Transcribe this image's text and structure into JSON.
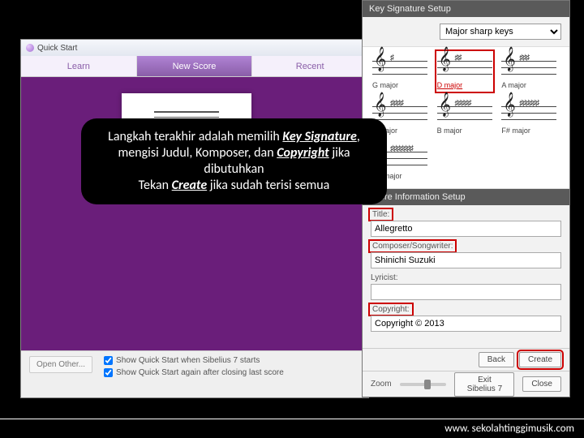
{
  "quickstart": {
    "title": "Quick Start",
    "tabs": [
      "Learn",
      "New Score",
      "Recent"
    ],
    "active_tab": 1,
    "open_other_label": "Open Other...",
    "check1": "Show Quick Start when Sibelius 7 starts",
    "check2": "Show Quick Start again after closing last score"
  },
  "callout": {
    "line1_pre": "Langkah terakhir adalah memilih ",
    "line1_em": "Key Signature",
    "line1_post": ",",
    "line2_pre": "mengisi Judul, Komposer, dan ",
    "line2_em": "Copyright",
    "line2_post": " jika dibutuhkan",
    "line3_pre": "Tekan ",
    "line3_em": "Create",
    "line3_post": " jika sudah terisi semua"
  },
  "setup": {
    "keysig_header": "Key Signature Setup",
    "keytype": "Major sharp keys",
    "keysigs": [
      {
        "label": "G major",
        "sharps": "♯"
      },
      {
        "label": "D major",
        "sharps": "♯♯",
        "selected": true
      },
      {
        "label": "A major",
        "sharps": "♯♯♯"
      },
      {
        "label": "E major",
        "sharps": "♯♯♯♯"
      },
      {
        "label": "B major",
        "sharps": "♯♯♯♯♯"
      },
      {
        "label": "F# major",
        "sharps": "♯♯♯♯♯♯"
      },
      {
        "label": "C# major",
        "sharps": "♯♯♯♯♯♯♯"
      }
    ],
    "info_header": "Score Information Setup",
    "fields": {
      "title_label": "Title:",
      "title_value": "Allegretto",
      "composer_label": "Composer/Songwriter:",
      "composer_value": "Shinichi Suzuki",
      "lyricist_label": "Lyricist:",
      "lyricist_value": "",
      "copyright_label": "Copyright:",
      "copyright_value": "Copyright © 2013"
    },
    "back_label": "Back",
    "create_label": "Create",
    "zoom_label": "Zoom",
    "exit_label": "Exit Sibelius 7",
    "close_label": "Close"
  },
  "footer": {
    "url": "www. sekolahtinggimusik.com"
  }
}
